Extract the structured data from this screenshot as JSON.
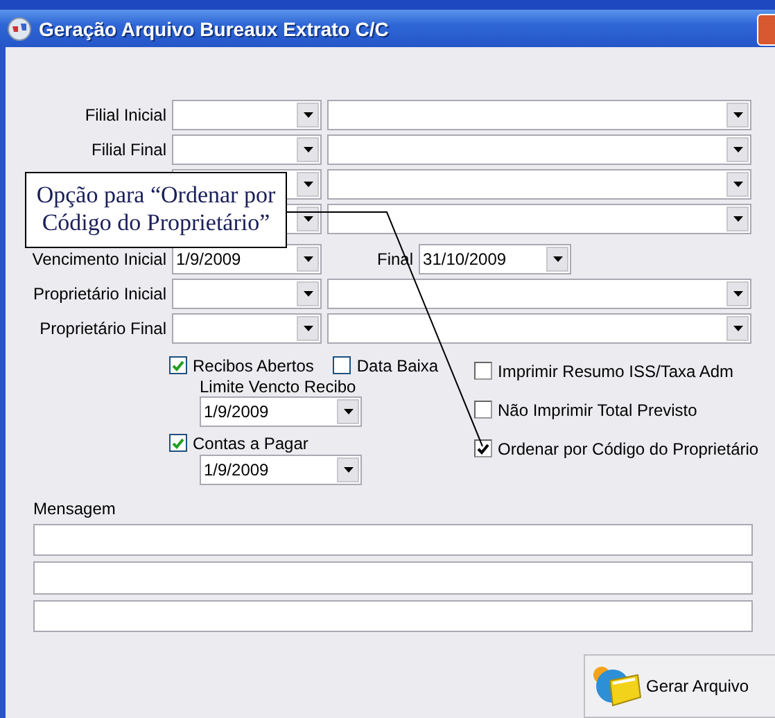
{
  "window": {
    "title": "Geração Arquivo Bureaux Extrato C/C"
  },
  "filters": [
    {
      "kind": "labeled",
      "label": "Filial Inicial"
    },
    {
      "kind": "labeled",
      "label": "Filial Final"
    },
    {
      "kind": "covered"
    },
    {
      "kind": "covered"
    }
  ],
  "vencimento": {
    "label": "Vencimento Inicial",
    "value": "1/9/2009",
    "final_label": "Final",
    "final_value": "31/10/2009"
  },
  "proprietarios": [
    {
      "label": "Proprietário Inicial"
    },
    {
      "label": "Proprietário Final"
    }
  ],
  "left_options": [
    {
      "label": "Recibos Abertos",
      "checked": true
    },
    {
      "label": "Data Baixa",
      "checked": false
    }
  ],
  "limite": {
    "label": "Limite Vencto Recibo",
    "value": "1/9/2009"
  },
  "contas": {
    "label": "Contas a Pagar",
    "checked": true,
    "value": "1/9/2009"
  },
  "right_options": [
    {
      "label": "Imprimir Resumo ISS/Taxa Adm",
      "checked": false
    },
    {
      "label": "Não Imprimir Total Previsto",
      "checked": false
    },
    {
      "label": "Ordenar por Código do Proprietário",
      "checked": true
    }
  ],
  "mensagem": {
    "label": "Mensagem"
  },
  "callout": {
    "text": "Opção para “Ordenar por Código do Proprietário”"
  },
  "button": {
    "label": "Gerar Arquivo"
  }
}
